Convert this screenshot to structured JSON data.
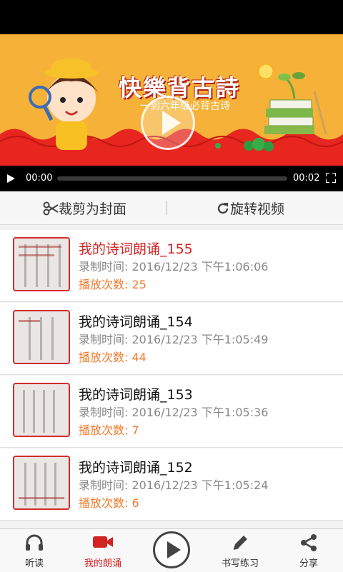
{
  "video": {
    "banner_title": "快樂背古詩",
    "banner_subtitle": "一到六年级必背古诗",
    "time_current": "00:00",
    "time_total": "00:02",
    "progress": 0
  },
  "actions": {
    "crop_label": "裁剪为封面",
    "rotate_label": "旋转视频"
  },
  "recordings": [
    {
      "title": "我的诗词朗诵_155",
      "time_label": "录制时间: 2016/12/23 下午1:06:06",
      "plays_label": "播放次数: 25",
      "active": true
    },
    {
      "title": "我的诗词朗诵_154",
      "time_label": "录制时间: 2016/12/23 下午1:05:49",
      "plays_label": "播放次数: 44",
      "active": false
    },
    {
      "title": "我的诗词朗诵_153",
      "time_label": "录制时间: 2016/12/23 下午1:05:36",
      "plays_label": "播放次数: 7",
      "active": false
    },
    {
      "title": "我的诗词朗诵_152",
      "time_label": "录制时间: 2016/12/23 下午1:05:24",
      "plays_label": "播放次数: 6",
      "active": false
    }
  ],
  "bottom_nav": {
    "listen": "听读",
    "my_recital": "我的朗诵",
    "writing": "书写练习",
    "share": "分享"
  },
  "colors": {
    "accent": "#d32222",
    "count": "#f07a2b",
    "banner_bg": "#f6b238"
  }
}
